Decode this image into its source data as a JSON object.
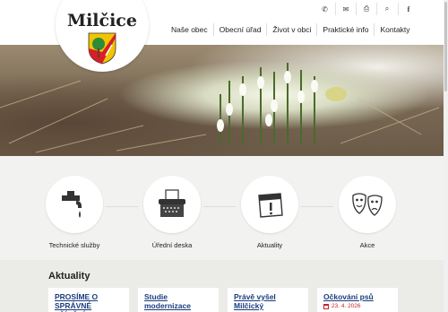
{
  "site": {
    "title": "Milčice"
  },
  "header": {
    "util_icons": [
      "phone-icon",
      "mail-icon",
      "print-icon",
      "search-icon",
      "facebook-icon"
    ],
    "nav": [
      "Naše obec",
      "Obecní úřad",
      "Život v obci",
      "Praktické info",
      "Kontakty"
    ]
  },
  "tiles": [
    {
      "label": "Technické služby",
      "icon": "water-tap-icon"
    },
    {
      "label": "Úřední deska",
      "icon": "typewriter-icon"
    },
    {
      "label": "Aktuality",
      "icon": "calendar-icon"
    },
    {
      "label": "Akce",
      "icon": "theater-masks-icon"
    }
  ],
  "news": {
    "heading": "Aktuality",
    "cards": [
      {
        "title": "PROSÍME O SPRÁVNÉ TŘÍDĚNÍ",
        "date": ""
      },
      {
        "title": "Studie modernizace zastávky Tatce",
        "date": ""
      },
      {
        "title": "Právě vyšel Milčický Zpravodaj ne",
        "date": ""
      },
      {
        "title": "Očkování psů",
        "date": "23. 4. 2026"
      }
    ]
  },
  "colors": {
    "link": "#1a3c7e",
    "date": "#cc2222",
    "coat_yellow": "#f2c400",
    "coat_red": "#d3202a",
    "coat_green": "#2e8b3a"
  }
}
